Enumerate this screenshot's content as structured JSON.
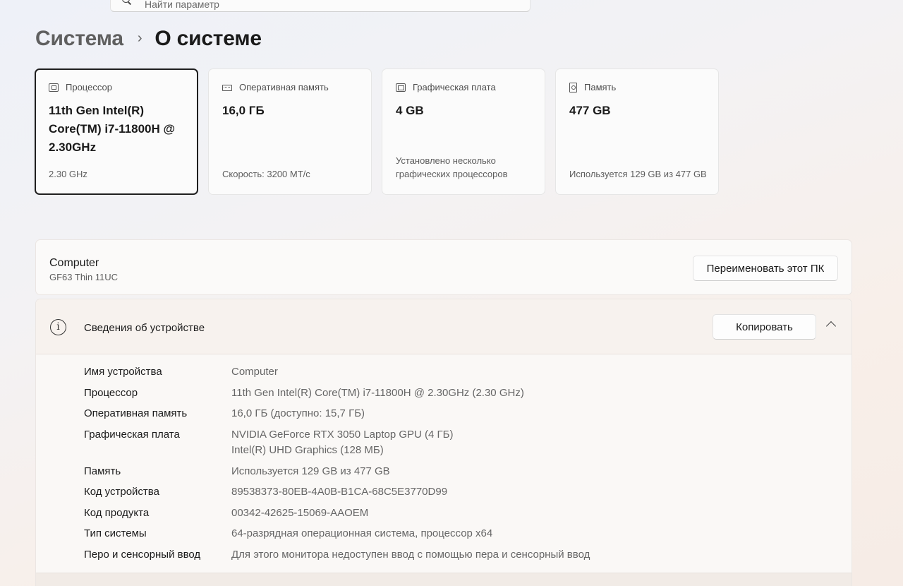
{
  "search": {
    "placeholder": "Найти параметр"
  },
  "breadcrumb": {
    "parent": "Система",
    "separator": "›",
    "current": "О системе"
  },
  "cards": [
    {
      "icon": "processor-icon",
      "label": "Процессор",
      "value": "11th Gen Intel(R) Core(TM) i7-11800H @ 2.30GHz",
      "sub": "2.30 GHz",
      "selected": true
    },
    {
      "icon": "ram-icon",
      "label": "Оперативная память",
      "value": "16,0 ГБ",
      "sub": "Скорость: 3200 МТ/с"
    },
    {
      "icon": "gpu-icon",
      "label": "Графическая плата",
      "value": "4 GB",
      "sub": "Установлено несколько графических процессоров"
    },
    {
      "icon": "storage-icon",
      "label": "Память",
      "value": "477 GB",
      "sub": "Используется 129 GB из 477 GB"
    }
  ],
  "computer": {
    "name": "Computer",
    "model": "GF63 Thin 11UC",
    "rename_label": "Переименовать этот ПК"
  },
  "device_info": {
    "title": "Сведения об устройстве",
    "copy_label": "Копировать",
    "rows": [
      {
        "key": "Имя устройства",
        "values": [
          "Computer"
        ]
      },
      {
        "key": "Процессор",
        "values": [
          "11th Gen Intel(R) Core(TM) i7-11800H @ 2.30GHz (2.30 GHz)"
        ]
      },
      {
        "key": "Оперативная память",
        "values": [
          "16,0 ГБ (доступно: 15,7 ГБ)"
        ]
      },
      {
        "key": "Графическая плата",
        "values": [
          "NVIDIA GeForce RTX 3050 Laptop GPU (4 ГБ)",
          "Intel(R) UHD Graphics (128 МБ)"
        ]
      },
      {
        "key": "Память",
        "values": [
          "Используется 129 GB из 477 GB"
        ]
      },
      {
        "key": "Код устройства",
        "values": [
          "89538373-80EB-4A0B-B1CA-68C5E3770D99"
        ]
      },
      {
        "key": "Код продукта",
        "values": [
          "00342-42625-15069-AAOEM"
        ]
      },
      {
        "key": "Тип системы",
        "values": [
          "64-разрядная операционная система, процессор x64"
        ]
      },
      {
        "key": "Перо и сенсорный ввод",
        "values": [
          "Для этого монитора недоступен ввод с помощью пера и сенсорный ввод"
        ]
      }
    ]
  }
}
